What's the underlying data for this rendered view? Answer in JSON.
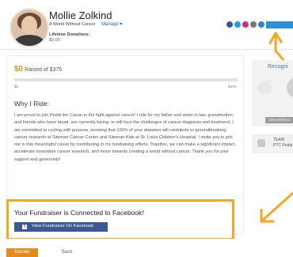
{
  "header": {
    "name": "Mollie Zolkind",
    "org": "A World Without Cancer",
    "manage_label": "Manage",
    "lifetime_label": "Lifetime Donations:",
    "lifetime_value": "$0.00"
  },
  "social": [
    "facebook-icon",
    "twitter-icon",
    "instagram-icon",
    "link-icon",
    "email-icon"
  ],
  "fundraising": {
    "raised_amount": "$0",
    "raised_label": "Raised of $375",
    "goal_min": "$0",
    "goal_max": "$375",
    "progress_fraction": 0
  },
  "why": {
    "title": "Why I Ride:",
    "story": "I am proud to join Pedal the Cause in the fight against cancer! I ride for my father and sister in law, grandmother, and friends who have faced, are currently facing, or will face the challenges of cancer diagnosis and treatment. I am committed to cycling with purpose, knowing that 100% of your donation will contribute to groundbreaking cancer research at Siteman Cancer Center and Siteman Kids at St. Louis Children's Hospital. I invite you to join me in this meaningful cause by contributing to my fundraising efforts. Together, we can make a significant impact, accelerate innovative cancer research, and move towards creating a world without cancer. Thank you for your support and generosity!"
  },
  "sidebar": {
    "recognition_title": "Recogni",
    "view_all_label": "View All Reco",
    "team_label": "TEAM",
    "team_name": "PTC Pedal"
  },
  "facebook": {
    "title": "Your Fundraiser is Connected to Facebook!",
    "button_label": "View Fundraiser On Facebook"
  },
  "footer": {
    "donate_label": "Donate",
    "back_label": "Back"
  },
  "colors": {
    "accent_orange": "#e68a1c",
    "highlight_orange": "#f5a623",
    "facebook_blue": "#3b5998",
    "link_blue": "#2b62a8"
  }
}
